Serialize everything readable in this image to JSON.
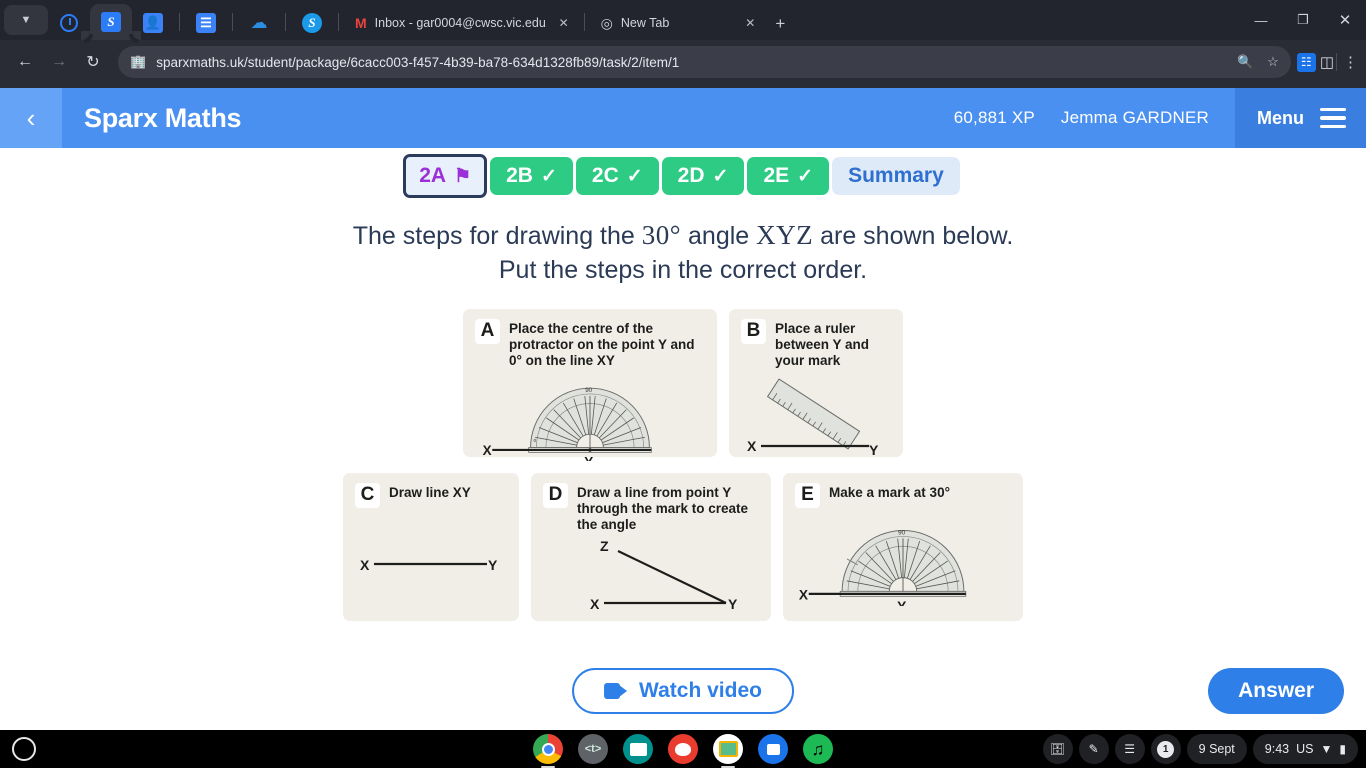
{
  "browser": {
    "pinned_tabs": [
      {
        "name": "compass-tab",
        "icon": "compass-icon",
        "active": false
      },
      {
        "name": "sparx-tab",
        "icon": "sparx-s-icon",
        "label": "S",
        "active": true
      },
      {
        "name": "contacts-tab",
        "icon": "contact-card-icon",
        "active": false
      },
      {
        "name": "docs-tab",
        "icon": "document-lines-icon",
        "active": false
      },
      {
        "name": "onedrive-tab",
        "icon": "cloud-icon",
        "active": false
      },
      {
        "name": "sparx-round-tab",
        "icon": "sparx-round-icon",
        "label": "S",
        "active": false
      }
    ],
    "tabs": [
      {
        "title": "Inbox - gar0004@cwsc.vic.edu.",
        "icon": "gmail-icon"
      },
      {
        "title": "New Tab",
        "icon": "chrome-new-tab-icon"
      }
    ],
    "new_tab_label": "+",
    "url": "sparxmaths.uk/student/package/6cacc003-f457-4b39-ba78-634d1328fb89/task/2/item/1",
    "window_controls": {
      "minimize": "—",
      "maximize": "❐",
      "close": "✕"
    }
  },
  "sparx": {
    "back_label": "‹",
    "title": "Sparx Maths",
    "xp": "60,881 XP",
    "student_name": "Jemma GARDNER",
    "menu_label": "Menu",
    "accent_blue": "#4a90f0",
    "menu_blue": "#3a7fe0",
    "tabs": [
      {
        "label": "2A",
        "state": "current",
        "marker": "flag"
      },
      {
        "label": "2B",
        "state": "done",
        "marker": "tick"
      },
      {
        "label": "2C",
        "state": "done",
        "marker": "tick"
      },
      {
        "label": "2D",
        "state": "done",
        "marker": "tick"
      },
      {
        "label": "2E",
        "state": "done",
        "marker": "tick"
      },
      {
        "label": "Summary",
        "state": "summary",
        "marker": "none"
      }
    ]
  },
  "question": {
    "line1_a": "The steps for drawing the ",
    "line1_angle": "30°",
    "line1_b": " angle ",
    "line1_xyz": "XYZ",
    "line1_c": " are shown below.",
    "line2": "Put the steps in the correct order."
  },
  "cards": [
    {
      "letter": "A",
      "text": "Place the centre of the protractor on the point Y and 0° on the line XY",
      "figure": "protractor-on-line-xy"
    },
    {
      "letter": "B",
      "text": "Place a ruler between Y and your mark",
      "figure": "ruler-on-line-xy"
    },
    {
      "letter": "C",
      "text": "Draw line XY",
      "figure": "line-xy"
    },
    {
      "letter": "D",
      "text": "Draw a line from point Y through the mark to create the angle",
      "figure": "angle-xyz"
    },
    {
      "letter": "E",
      "text": "Make a mark at 30°",
      "figure": "protractor-with-mark"
    }
  ],
  "actions": {
    "watch_video": "Watch video",
    "answer": "Answer"
  },
  "shelf": {
    "apps": [
      {
        "name": "chrome",
        "running": true
      },
      {
        "name": "texthelp",
        "label": "<t>",
        "running": false
      },
      {
        "name": "news",
        "running": false
      },
      {
        "name": "art-palette",
        "running": false
      },
      {
        "name": "google-classroom",
        "running": true
      },
      {
        "name": "camera",
        "running": false
      },
      {
        "name": "spotify",
        "running": false
      }
    ],
    "notification_count": "1",
    "date": "9 Sept",
    "time": "9:43",
    "locale": "US"
  }
}
